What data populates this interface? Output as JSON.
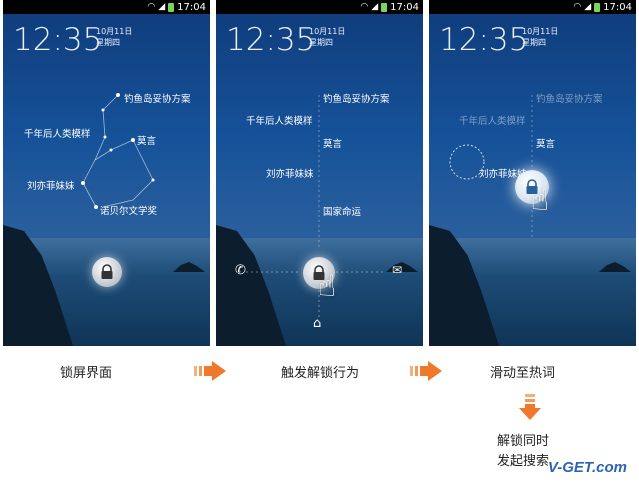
{
  "status_time": "17:04",
  "lock_time": "12:35",
  "date_line1": "10月11日",
  "date_line2": "星期四",
  "screen1": {
    "words": [
      "钓鱼岛妥协方案",
      "千年后人类模样",
      "莫言",
      "刘亦菲妹妹",
      "诺贝尔文学奖"
    ]
  },
  "screen2": {
    "words": [
      "钓鱼岛妥协方案",
      "千年后人类模样",
      "莫言",
      "刘亦菲妹妹",
      "国家命运"
    ]
  },
  "screen3": {
    "words": [
      "钓鱼岛妥协方案",
      "千年后人类模样",
      "莫言",
      "刘亦菲妹妹"
    ]
  },
  "captions": {
    "step1": "锁屏界面",
    "step2": "触发解锁行为",
    "step3": "滑动至热词"
  },
  "result": {
    "line1": "解锁同时",
    "line2": "发起搜索"
  },
  "watermark": "V-GET.com",
  "colors": {
    "arrow": "#f0782a",
    "sky": "#165299"
  }
}
